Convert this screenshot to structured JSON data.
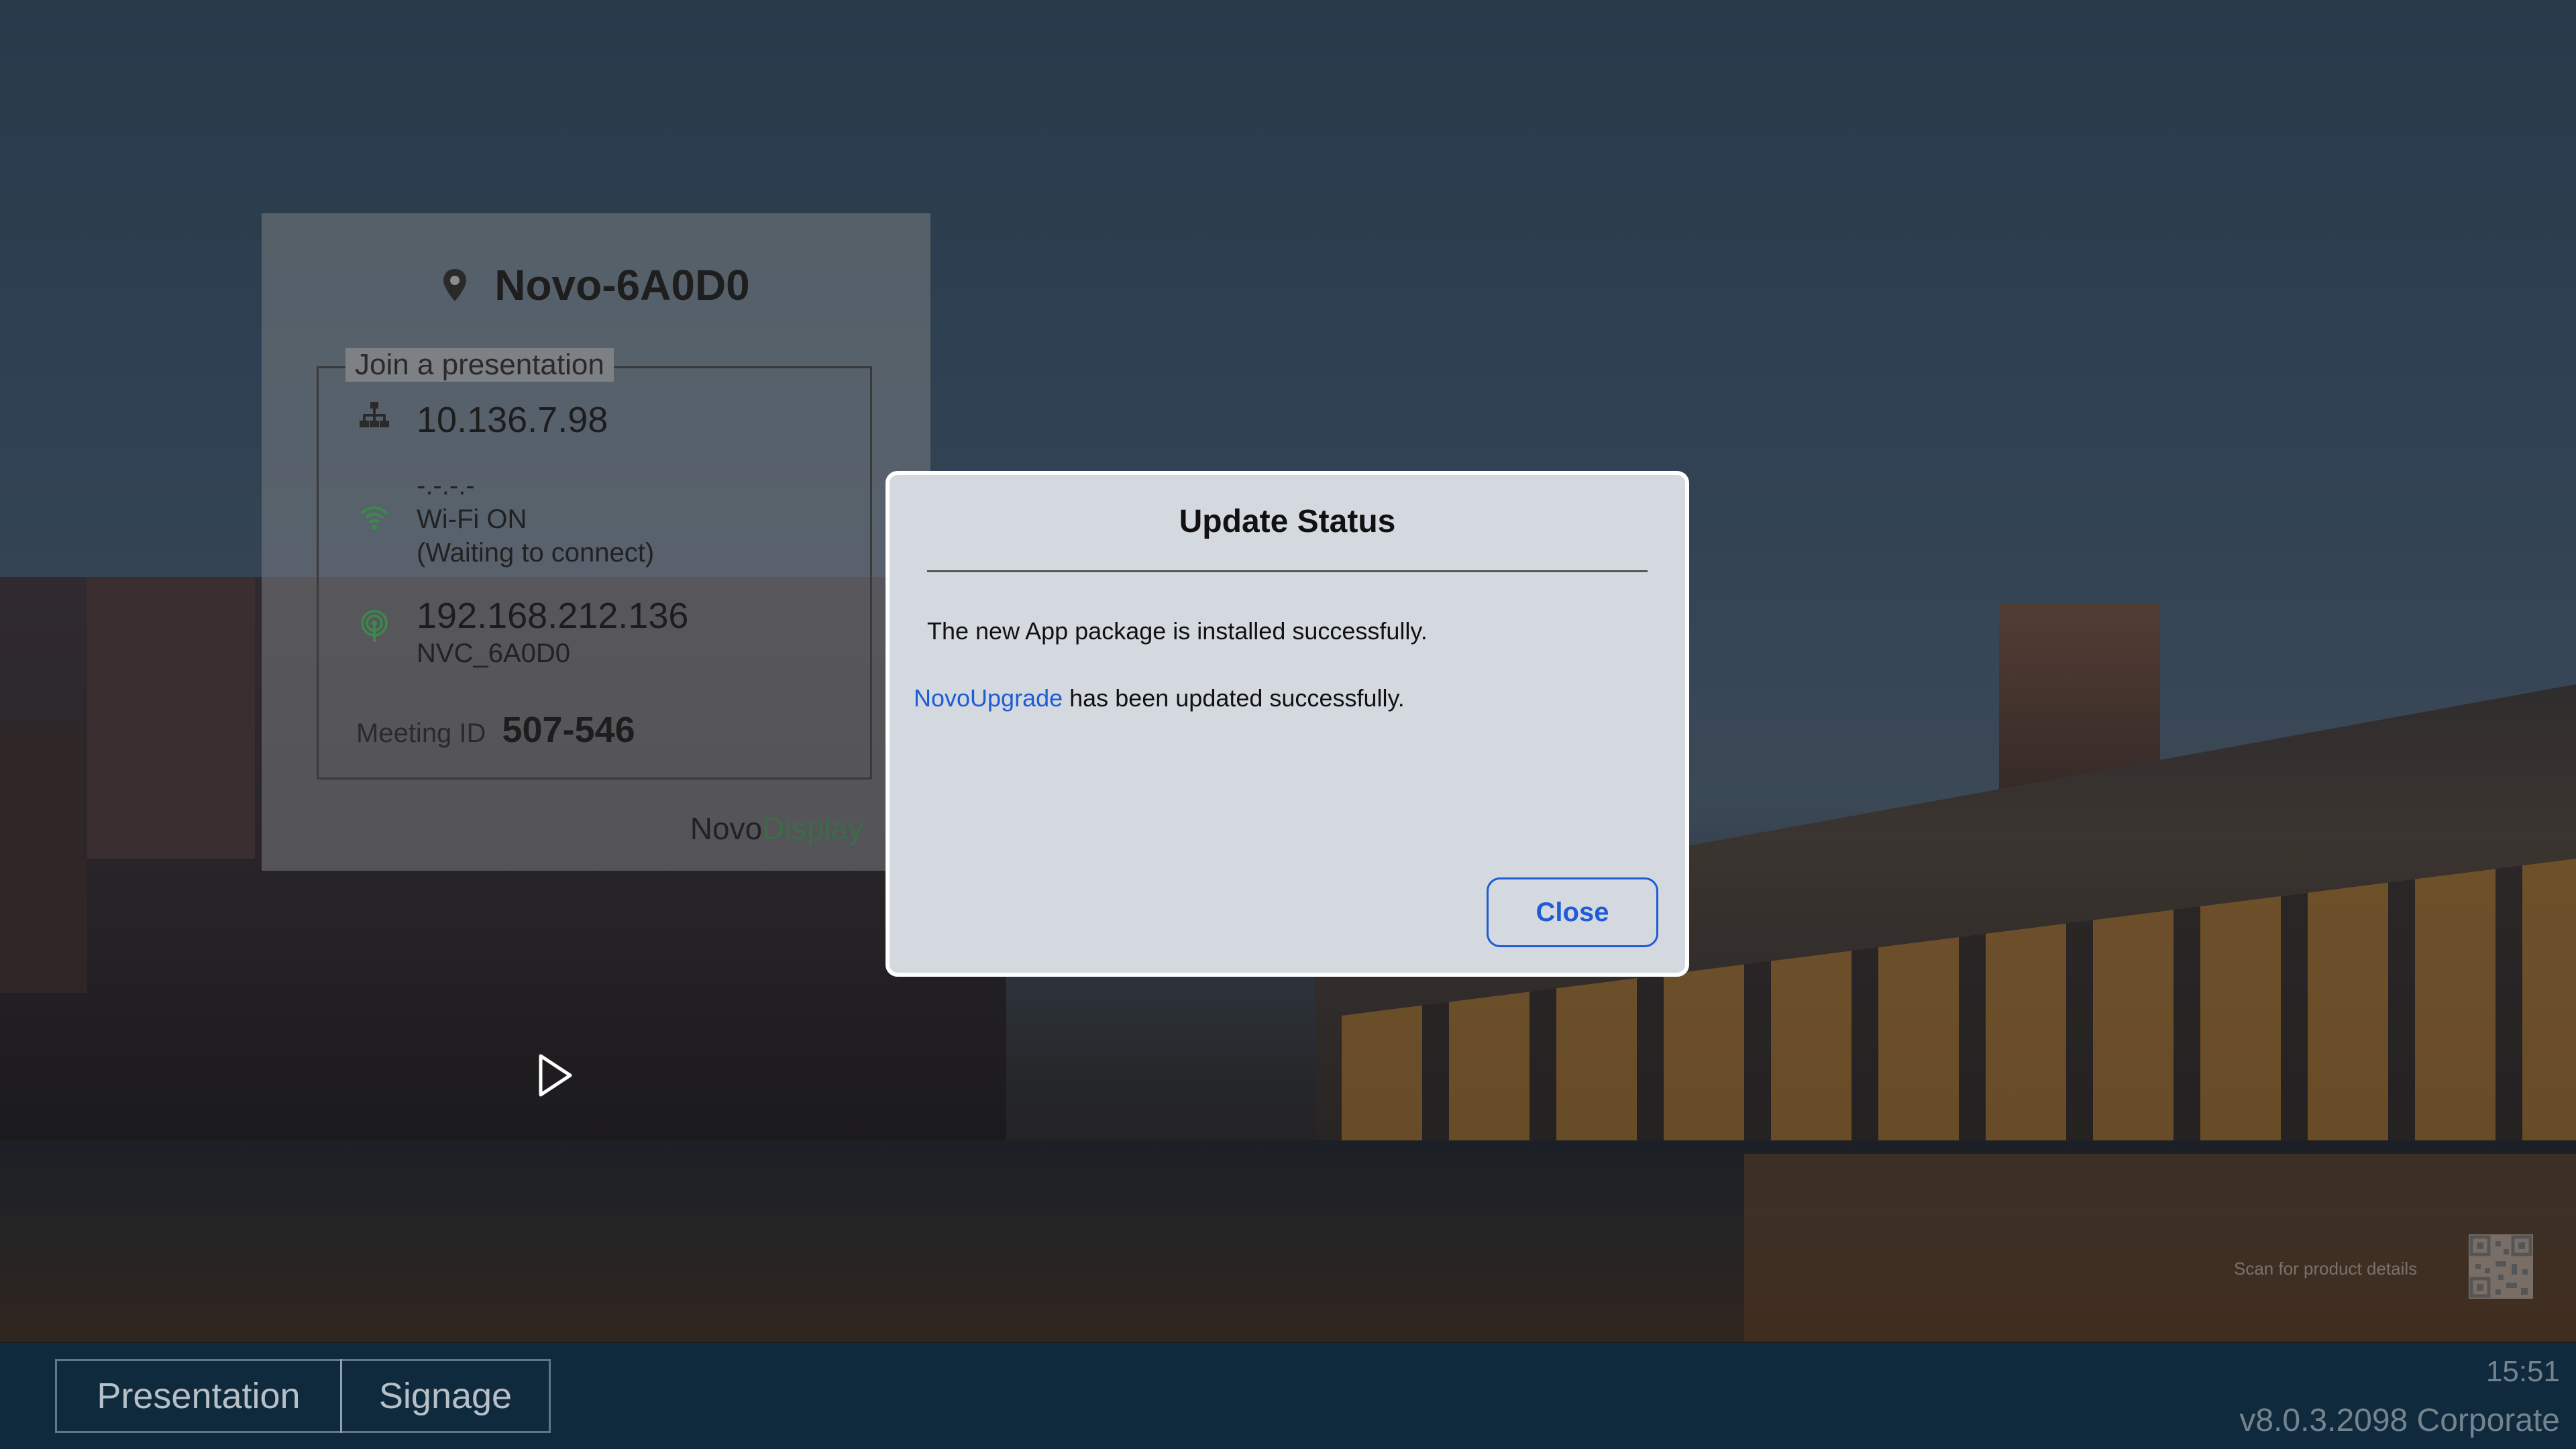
{
  "info_card": {
    "device_name": "Novo-6A0D0",
    "join_legend": "Join a presentation",
    "lan_ip": "10.136.7.98",
    "wifi_ip": "-.-.-.-",
    "wifi_status": "Wi-Fi ON",
    "wifi_substatus": "(Waiting to connect)",
    "hotspot_ip": "192.168.212.136",
    "hotspot_ssid": "NVC_6A0D0",
    "meeting_label": "Meeting ID",
    "meeting_id": "507-546",
    "brand_part1": "Novo",
    "brand_part2": "Display"
  },
  "dialog": {
    "title": "Update Status",
    "message1": "The new App package is installed successfully.",
    "message2_link": "NovoUpgrade",
    "message2_rest": " has been updated successfully.",
    "close_label": "Close"
  },
  "qr": {
    "label": "Scan for product details"
  },
  "bottom_bar": {
    "tabs": [
      {
        "label": "Presentation"
      },
      {
        "label": "Signage"
      }
    ],
    "clock": "15:51",
    "version": "v8.0.3.2098 Corporate"
  },
  "colors": {
    "accent": "#1f5bd6",
    "wifi_green": "#3a8a4a",
    "bar_bg": "#0f2a3c",
    "dialog_bg": "#d4d9e0"
  },
  "icons": [
    "location-pin-icon",
    "lan-network-icon",
    "wifi-icon",
    "hotspot-icon",
    "cursor-pointer-icon",
    "qr-code-icon"
  ]
}
